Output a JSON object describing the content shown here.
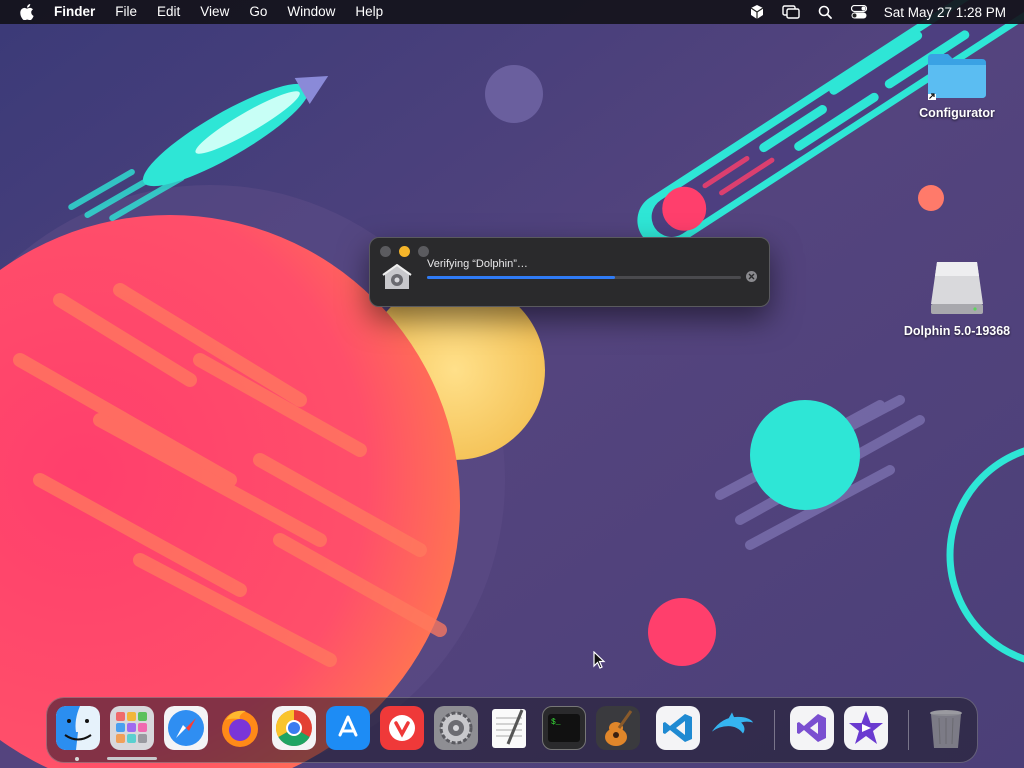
{
  "menubar": {
    "app_name": "Finder",
    "menus": [
      "File",
      "Edit",
      "View",
      "Go",
      "Window",
      "Help"
    ],
    "clock": "Sat May 27  1:28 PM",
    "status_icons": [
      "accessibility-cube-icon",
      "screen-mirroring-icon",
      "spotlight-search-icon",
      "control-center-icon"
    ]
  },
  "desktop": {
    "icons": [
      {
        "label": "Configurator",
        "icon": "folder-alias-icon"
      },
      {
        "label": "Dolphin 5.0-19368",
        "icon": "disk-image-icon"
      }
    ]
  },
  "verify_window": {
    "title": "Verifying “Dolphin”…",
    "progress": 0.6
  },
  "dock": {
    "apps": [
      {
        "name": "Finder",
        "icon": "finder-icon",
        "running": true
      },
      {
        "name": "Launchpad",
        "icon": "launchpad-icon",
        "running": false
      },
      {
        "name": "Safari",
        "icon": "safari-icon",
        "running": false
      },
      {
        "name": "Firefox",
        "icon": "firefox-icon",
        "running": false
      },
      {
        "name": "Google Chrome",
        "icon": "chrome-icon",
        "running": false
      },
      {
        "name": "App Store",
        "icon": "app-store-icon",
        "running": false
      },
      {
        "name": "Vivaldi",
        "icon": "vivaldi-icon",
        "running": false
      },
      {
        "name": "System Preferences",
        "icon": "system-preferences-icon",
        "running": false
      },
      {
        "name": "TextEdit",
        "icon": "textedit-icon",
        "running": false
      },
      {
        "name": "Terminal",
        "icon": "terminal-icon",
        "running": false
      },
      {
        "name": "GarageBand",
        "icon": "garageband-icon",
        "running": false
      },
      {
        "name": "Visual Studio Code",
        "icon": "vscode-icon",
        "running": false
      },
      {
        "name": "Dolphin",
        "icon": "dolphin-icon",
        "running": false
      },
      {
        "name": "Visual Studio",
        "icon": "visual-studio-icon",
        "running": false
      },
      {
        "name": "iMovie",
        "icon": "imovie-icon",
        "running": false
      },
      {
        "name": "Trash",
        "icon": "trash-icon",
        "running": false
      }
    ]
  }
}
